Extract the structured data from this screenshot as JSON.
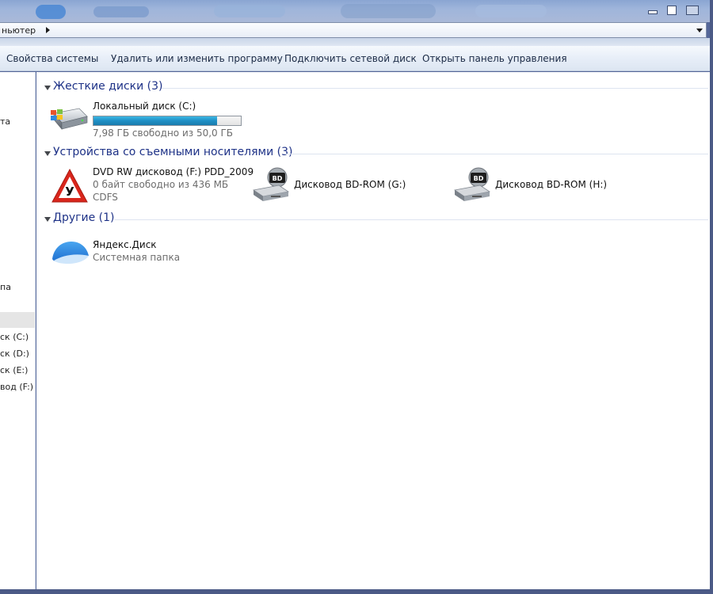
{
  "window": {
    "address_text": "ньютер",
    "buttons": {
      "minimize": "minimize",
      "maximize": "maximize",
      "close": "close"
    }
  },
  "commandbar": {
    "system_properties": "Свойства системы",
    "uninstall_program": "Удалить или изменить программу",
    "map_network_drive": "Подключить сетевой диск",
    "open_control_panel": "Открыть панель управления"
  },
  "navpane": {
    "items": [
      {
        "label": "та"
      },
      {
        "label": "па"
      },
      {
        "label": "ск (C:)"
      },
      {
        "label": "ск (D:)"
      },
      {
        "label": "ск (E:)"
      },
      {
        "label": "вод (F:)"
      }
    ]
  },
  "groups": {
    "hard_disks": {
      "title": "Жесткие диски (3)",
      "items": [
        {
          "name": "Локальный диск (C:)",
          "free_text": "7,98 ГБ свободно из 50,0 ГБ",
          "used_fraction": 0.84,
          "icon": "hdd-windows-icon"
        }
      ]
    },
    "removable": {
      "title": "Устройства со съемными носителями (3)",
      "items": [
        {
          "name": "DVD RW дисковод (F:) PDD_2009",
          "free_text": "0 байт свободно из 436 МБ",
          "fs": "CDFS",
          "icon": "warning-sign-icon",
          "icon_letter": "У"
        },
        {
          "name": "Дисковод BD-ROM (G:)",
          "icon": "bd-rom-icon",
          "icon_letter": "BD"
        },
        {
          "name": "Дисковод BD-ROM (H:)",
          "icon": "bd-rom-icon",
          "icon_letter": "BD"
        }
      ]
    },
    "other": {
      "title": "Другие (1)",
      "items": [
        {
          "name": "Яндекс.Диск",
          "sub": "Системная папка",
          "icon": "yandex-disk-icon"
        }
      ]
    }
  },
  "colors": {
    "group_title": "#1e3287",
    "bar_fill": "#1f8fc5",
    "frame": "#4b5a86"
  }
}
